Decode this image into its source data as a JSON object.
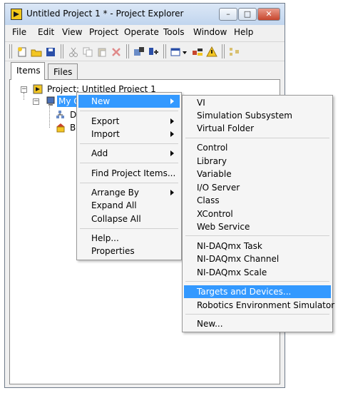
{
  "window": {
    "title": "Untitled Project 1 * - Project Explorer",
    "controls": {
      "minimize": "–",
      "maximize": "□",
      "close": "✕"
    }
  },
  "menubar": [
    "File",
    "Edit",
    "View",
    "Project",
    "Operate",
    "Tools",
    "Window",
    "Help"
  ],
  "toolbar": {
    "icons": [
      "new-icon",
      "open-icon",
      "save-all-icon",
      "cut-icon",
      "copy-icon",
      "paste-icon",
      "delete-icon",
      "build-icon",
      "deploy-icon",
      "view-icon",
      "dropdown-icon",
      "filter-icon",
      "warning-icon",
      "dependencies-icon"
    ]
  },
  "tabs": [
    "Items",
    "Files"
  ],
  "tree": {
    "project": "Project: Untitled Project 1",
    "computer_visible": "My C",
    "child1_visible": "D",
    "child2_visible": "B"
  },
  "context_menu": {
    "items": [
      {
        "label": "New",
        "submenu": true,
        "highlighted": true
      },
      {
        "label": "Export",
        "submenu": true
      },
      {
        "label": "Import",
        "submenu": true
      },
      {
        "label": "Add",
        "submenu": true
      },
      {
        "label": "Find Project Items..."
      },
      {
        "label": "Arrange By",
        "submenu": true
      },
      {
        "label": "Expand All"
      },
      {
        "label": "Collapse All"
      },
      {
        "label": "Help..."
      },
      {
        "label": "Properties"
      }
    ]
  },
  "submenu": {
    "items": [
      "VI",
      "Simulation Subsystem",
      "Virtual Folder",
      "Control",
      "Library",
      "Variable",
      "I/O Server",
      "Class",
      "XControl",
      "Web Service",
      "NI-DAQmx Task",
      "NI-DAQmx Channel",
      "NI-DAQmx Scale",
      "Targets and Devices...",
      "Robotics Environment Simulator",
      "New..."
    ],
    "highlighted": "Targets and Devices..."
  },
  "colors": {
    "highlight": "#3399ff",
    "titlebar": "#c9dbf2"
  }
}
